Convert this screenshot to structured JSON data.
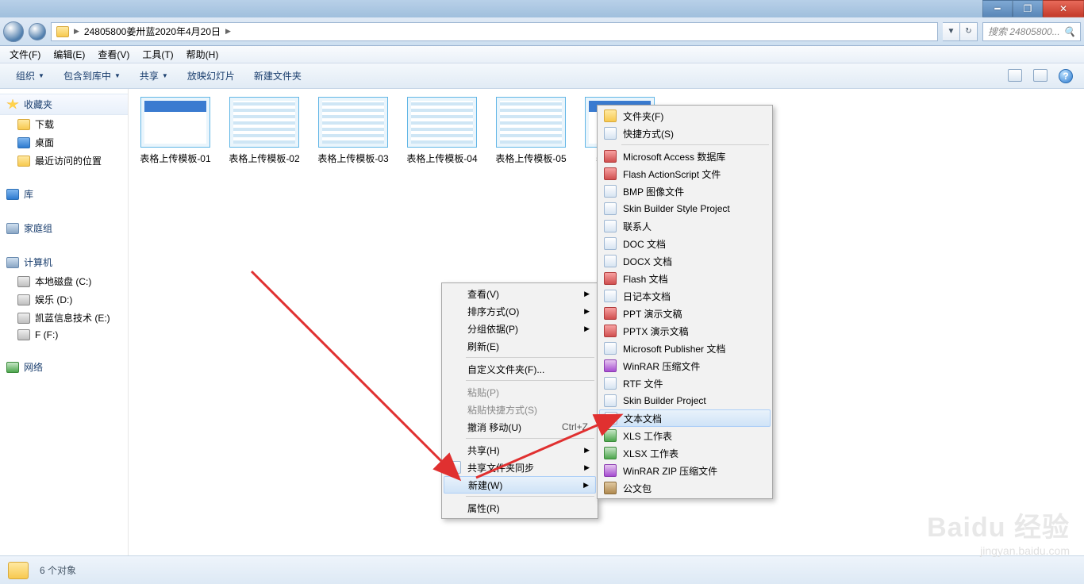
{
  "window": {
    "title": "24805800姜卅蓝2020年4月20日"
  },
  "address": {
    "crumb": "24805800姜卅蓝2020年4月20日"
  },
  "search": {
    "placeholder": "搜索 24805800..."
  },
  "menubar": [
    "文件(F)",
    "编辑(E)",
    "查看(V)",
    "工具(T)",
    "帮助(H)"
  ],
  "toolbar": {
    "organize": "组织",
    "include": "包含到库中",
    "share": "共享",
    "slideshow": "放映幻灯片",
    "newfolder": "新建文件夹"
  },
  "sidebar": {
    "favorites": "收藏夹",
    "fav_items": [
      "下载",
      "桌面",
      "最近访问的位置"
    ],
    "library": "库",
    "homegroup": "家庭组",
    "computer": "计算机",
    "drives": [
      "本地磁盘 (C:)",
      "娱乐 (D:)",
      "凯蓝信息技术 (E:)",
      "F (F:)"
    ],
    "network": "网络"
  },
  "files": [
    {
      "name": "表格上传模板-01"
    },
    {
      "name": "表格上传模板-02"
    },
    {
      "name": "表格上传模板-03"
    },
    {
      "name": "表格上传模板-04"
    },
    {
      "name": "表格上传模板-05"
    },
    {
      "name": "表格上传模"
    }
  ],
  "ctx1": {
    "view": "查看(V)",
    "sort": "排序方式(O)",
    "group": "分组依据(P)",
    "refresh": "刷新(E)",
    "custom": "自定义文件夹(F)...",
    "paste": "粘贴(P)",
    "paste_shortcut": "粘贴快捷方式(S)",
    "undo": "撤消 移动(U)",
    "undo_key": "Ctrl+Z",
    "share": "共享(H)",
    "sync": "共享文件夹同步",
    "new": "新建(W)",
    "props": "属性(R)"
  },
  "ctx2": {
    "items": [
      {
        "label": "文件夹(F)",
        "icon": "fold"
      },
      {
        "label": "快捷方式(S)",
        "icon": ""
      },
      {
        "label": "Microsoft Access 数据库",
        "icon": "red"
      },
      {
        "label": "Flash ActionScript 文件",
        "icon": "red"
      },
      {
        "label": "BMP 图像文件",
        "icon": ""
      },
      {
        "label": "Skin Builder Style Project",
        "icon": ""
      },
      {
        "label": "联系人",
        "icon": ""
      },
      {
        "label": "DOC 文档",
        "icon": ""
      },
      {
        "label": "DOCX 文档",
        "icon": ""
      },
      {
        "label": "Flash 文档",
        "icon": "red"
      },
      {
        "label": "日记本文档",
        "icon": ""
      },
      {
        "label": "PPT 演示文稿",
        "icon": "red"
      },
      {
        "label": "PPTX 演示文稿",
        "icon": "red"
      },
      {
        "label": "Microsoft Publisher 文档",
        "icon": ""
      },
      {
        "label": "WinRAR 压缩文件",
        "icon": "purple"
      },
      {
        "label": "RTF 文件",
        "icon": ""
      },
      {
        "label": "Skin Builder Project",
        "icon": ""
      },
      {
        "label": "文本文档",
        "icon": "",
        "hl": true
      },
      {
        "label": "XLS 工作表",
        "icon": "green"
      },
      {
        "label": "XLSX 工作表",
        "icon": "green"
      },
      {
        "label": "WinRAR ZIP 压缩文件",
        "icon": "purple"
      },
      {
        "label": "公文包",
        "icon": "bag"
      }
    ]
  },
  "statusbar": {
    "text": "6 个对象"
  },
  "watermark": {
    "brand": "Baidu 经验",
    "url": "jingyan.baidu.com"
  }
}
